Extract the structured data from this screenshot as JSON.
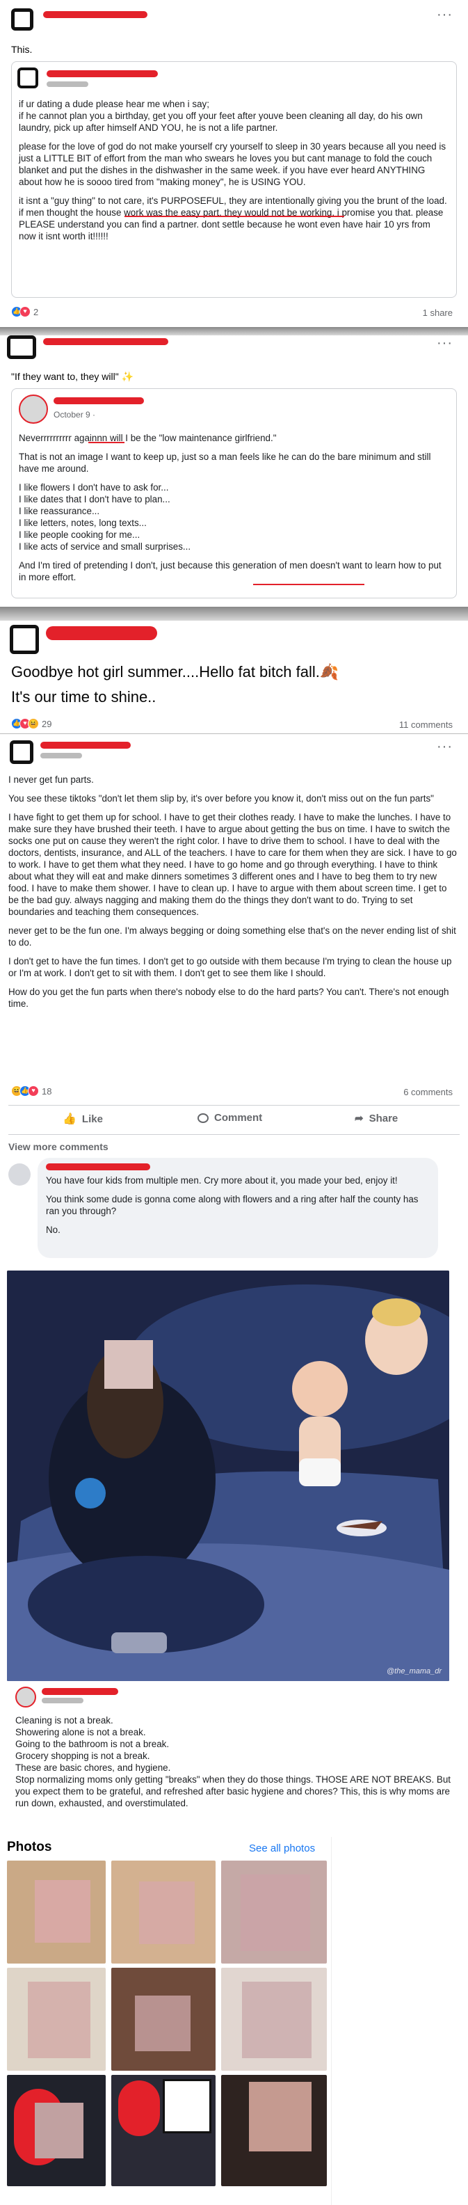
{
  "post1": {
    "text": "This.",
    "more": "···",
    "shared_card": {
      "paragraphs": [
        "if ur dating a dude please hear me when i say;\nif he cannot plan you a birthday, get you off your feet after youve been cleaning all day, do his own laundry, pick up after himself AND YOU, he is not a life partner.",
        "please for the love of god do not make yourself cry yourself to sleep in 30 years because all you need is just a LITTLE BIT of effort from the man who swears he loves you but cant manage to fold the couch blanket and put the dishes in the dishwasher in the same week. if you have ever heard ANYTHING about how he is soooo tired from \"making money\", he is USING YOU.",
        "it isnt a \"guy thing\" to not care, it's PURPOSEFUL, they are intentionally giving you the brunt of the load. if men thought the house work was the easy part, they would not be working. i promise you that. please PLEASE understand you can find a partner. dont settle because he wont even have hair 10 yrs from now it isnt worth it!!!!!!"
      ]
    },
    "reaction_count": "2",
    "share_count": "1 share"
  },
  "post2": {
    "text": "\"If they want to, they will\" ✨",
    "more": "···",
    "card": {
      "date": "October 9 · ",
      "paragraphs": [
        "Neverrrrrrrrrr againnn will I be the \"low maintenance girlfriend.\"",
        "That is not an image I want to keep up, just so a man feels like he can do the bare minimum and still have me around.",
        "I like flowers I don't have to ask for...\nI like dates that I don't have to plan...\nI like reassurance...\nI like letters, notes, long texts...\nI like people cooking for me...\nI like acts of service and small surprises...",
        "And I'm tired of pretending I don't, just because this generation of men doesn't want to learn how to put in more effort."
      ]
    }
  },
  "post3": {
    "text": "Goodbye hot girl summer....Hello fat bitch fall.🍂",
    "text2": "It's our time to shine..",
    "reaction_count": "29",
    "comment_count": "11 comments"
  },
  "post4": {
    "more": "···",
    "paragraphs": [
      "I never get fun parts.",
      "You see these tiktoks \"don't let them slip by, it's over before you know it, don't miss out on the fun parts\"",
      "I have fight to get them up for school. I have to get their clothes ready. I have to make the lunches. I have to make sure they have brushed their teeth. I have to argue about getting the bus on time. I have to switch the socks one put on cause they weren't the right color. I have to drive them to school. I have to deal with the doctors, dentists, insurance, and ALL of the teachers. I have to care for them when they are sick. I have to go to work. I have to get them what they need. I have to go home and go through everything. I have to think about what they will eat and make dinners sometimes 3 different ones and I have to beg them to try new food. I have to make them shower. I have to clean up. I have to argue with them about screen time. I get to be the bad guy. always nagging and making them do the things they don't want to do. Trying to set boundaries and teaching them consequences.",
      "never get to be the fun one. I'm always begging or doing something else that's on the never ending list of shit to do.",
      "I don't get to have the fun times. I don't get to go outside with them because I'm trying to clean the house up or I'm at work. I don't get to sit with them. I don't get to see them like I should.",
      "How do you get the fun parts when there's nobody else to do the hard parts? You can't. There's not enough time."
    ],
    "reaction_count": "18",
    "comment_count": "6 comments",
    "actions": {
      "like": "Like",
      "comment": "Comment",
      "share": "Share"
    },
    "view_more": "View more comments",
    "comment": {
      "lines": [
        "You have four kids from multiple men. Cry more about it, you made your bed, enjoy it!",
        "You think some dude is gonna come along with flowers and a ring after half the county has ran you through?",
        "No."
      ]
    }
  },
  "post5": {
    "watermark": "@the_mama_dr",
    "lines": [
      "Cleaning is not a break.",
      "Showering alone is not a break.",
      "Going to the bathroom is not a break.",
      "Grocery shopping is not a break.",
      "These are basic chores, and hygiene.",
      "Stop normalizing moms only getting \"breaks\" when they do those things. THOSE ARE NOT BREAKS. But you expect them to be grateful, and refreshed after basic hygiene and chores? This, this is why moms are run down, exhausted, and overstimulated."
    ]
  },
  "photos": {
    "title": "Photos",
    "see_all": "See all photos"
  },
  "colors": {
    "link": "#1877f2",
    "redaction": "#e3212a",
    "muted": "#65676b"
  }
}
